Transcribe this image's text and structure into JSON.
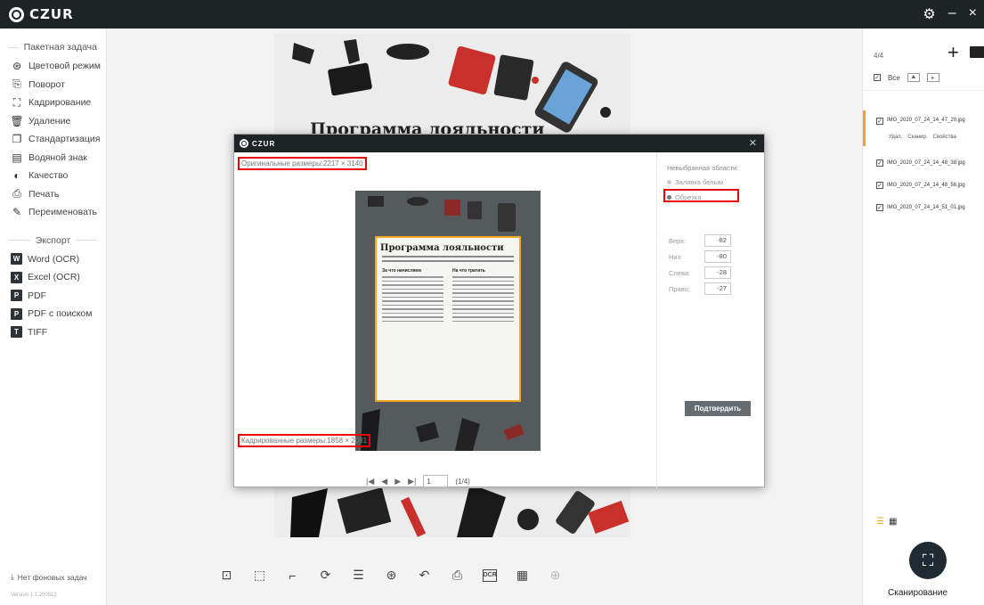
{
  "app": {
    "brand": "CZUR"
  },
  "titlebar": {
    "settings_icon": "gear-icon",
    "minimize_icon": "minimize-icon",
    "close_icon": "close-icon"
  },
  "sidebar": {
    "batch_header": "Пакетная задача",
    "batch_items": [
      {
        "label": "Цветовой режим",
        "icon": "palette-icon"
      },
      {
        "label": "Поворот",
        "icon": "rotate-icon"
      },
      {
        "label": "Кадрирование",
        "icon": "crop-icon"
      },
      {
        "label": "Удаление",
        "icon": "trash-icon"
      },
      {
        "label": "Стандартизация",
        "icon": "standardize-icon"
      },
      {
        "label": "Водяной знак",
        "icon": "watermark-icon"
      },
      {
        "label": "Качество",
        "icon": "quality-icon"
      },
      {
        "label": "Печать",
        "icon": "print-icon"
      },
      {
        "label": "Переименовать",
        "icon": "rename-icon"
      }
    ],
    "export_header": "Экспорт",
    "export_items": [
      {
        "label": "Word (OCR)",
        "badge": "W"
      },
      {
        "label": "Excel (OCR)",
        "badge": "X"
      },
      {
        "label": "PDF",
        "badge": "P"
      },
      {
        "label": "PDF с поиском",
        "badge": "P"
      },
      {
        "label": "TIFF",
        "badge": "T"
      }
    ],
    "background_tasks": "Нет фоновых задач",
    "version": "Version 1.1.200512"
  },
  "document": {
    "title": "Программа лояльности"
  },
  "modal": {
    "brand": "CZUR",
    "original_size": "Оригинальные размеры:2217 × 3140",
    "cropped_size": "Кадрированные размеры:1858 × 2081",
    "preview": {
      "page_title": "Программа лояльности",
      "col1_header": "За что начисляем",
      "col2_header": "На что тратить"
    },
    "pagination": {
      "page_value": "1",
      "page_info": "(1/4)"
    },
    "settings": {
      "title": "Невыбранная области:",
      "option_fill": "Заливка белым",
      "option_crop": "Обрезка",
      "top_label": "Верх:",
      "top_value": "-82",
      "bottom_label": "Низ:",
      "bottom_value": "-80",
      "left_label": "Слева:",
      "left_value": "-28",
      "right_label": "Право:",
      "right_value": "-27",
      "confirm": "Подтвердить"
    }
  },
  "rightpanel": {
    "count": "4/4",
    "select_all": "Все",
    "files": [
      {
        "name": "IMG_2020_07_24_14_47_20.jpg",
        "active": true
      },
      {
        "name": "IMG_2020_07_24_14_48_38.jpg"
      },
      {
        "name": "IMG_2020_07_24_14_48_56.jpg"
      },
      {
        "name": "IMG_2020_07_24_14_51_01.jpg"
      }
    ],
    "actions": {
      "delete": "Удал.",
      "scan": "Сканир.",
      "properties": "Свойства"
    },
    "scan_label": "Сканирование"
  },
  "colors": {
    "accent": "#f5a623",
    "highlight": "#e00000",
    "titlebar": "#1e2326"
  }
}
